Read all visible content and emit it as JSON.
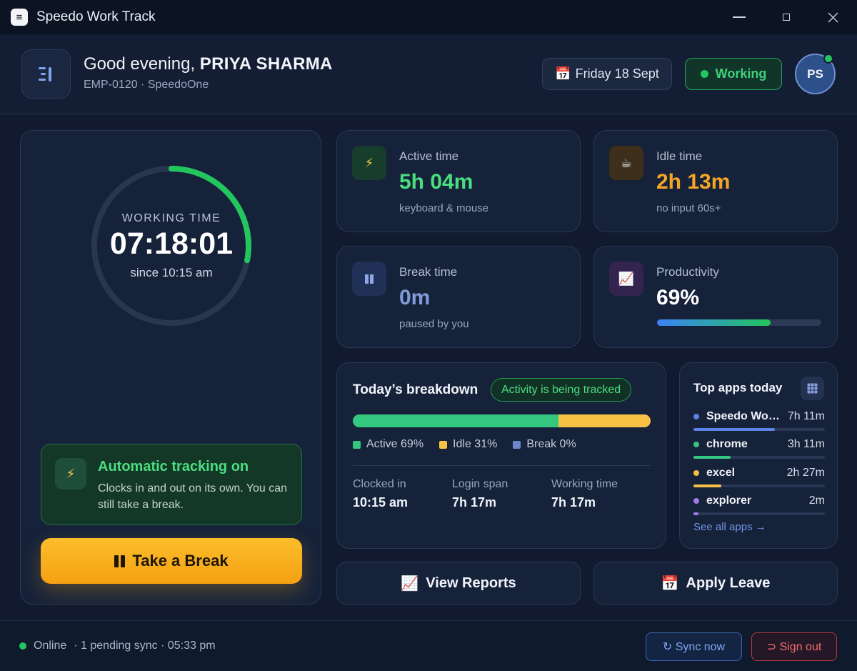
{
  "window": {
    "title": "Speedo Work Track"
  },
  "header": {
    "greeting_prefix": "Good evening,",
    "user_name": "PRIYA SHARMA",
    "subline": "EMP-0120 · SpeedoOne",
    "date_icon": "📅",
    "date_label": "Friday 18 Sept",
    "status_label": "Working",
    "avatar_initials": "PS"
  },
  "timer": {
    "label": "WORKING TIME",
    "value": "07:18:01",
    "since": "since 10:15 am",
    "ring_progress": 0.28
  },
  "auto_tracking": {
    "title": "Automatic tracking on",
    "description": "Clocks in and out on its own. You can still take a break."
  },
  "break_button": {
    "label": "Take a Break"
  },
  "stats": {
    "active": {
      "label": "Active time",
      "value": "5h 04m",
      "sub": "keyboard & mouse",
      "color": "#4ade80",
      "icon": "lightning-icon"
    },
    "idle": {
      "label": "Idle time",
      "value": "2h 13m",
      "sub": "no input 60s+",
      "color": "#f5a524",
      "icon": "coffee-icon"
    },
    "break": {
      "label": "Break time",
      "value": "0m",
      "sub": "paused by you",
      "color": "#7f9bd8",
      "icon": "pause-icon"
    },
    "productivity": {
      "label": "Productivity",
      "value": "69%",
      "fill": 0.69,
      "icon": "chart-up-icon"
    }
  },
  "breakdown": {
    "title": "Today’s breakdown",
    "tracking_pill": "Activity is being tracked",
    "segments": [
      {
        "name": "Active",
        "fraction": 0.69,
        "color": "#34c77f"
      },
      {
        "name": "Idle",
        "fraction": 0.31,
        "color": "#f6c144"
      },
      {
        "name": "Break",
        "fraction": 0.0,
        "color": "#6c86c8"
      }
    ],
    "legend": [
      "Active 69%",
      "Idle 31%",
      "Break 0%"
    ],
    "columns": [
      {
        "label": "Clocked in",
        "value": "10:15 am"
      },
      {
        "label": "Login span",
        "value": "7h 17m"
      },
      {
        "label": "Working time",
        "value": "7h 17m"
      }
    ]
  },
  "top_apps": {
    "title": "Top apps today",
    "items": [
      {
        "name": "Speedo Wo…",
        "time": "7h 11m",
        "color": "#5b82e6",
        "fill": 0.62
      },
      {
        "name": "chrome",
        "time": "3h 11m",
        "color": "#34c77f",
        "fill": 0.28
      },
      {
        "name": "excel",
        "time": "2h 27m",
        "color": "#f6c144",
        "fill": 0.21
      },
      {
        "name": "explorer",
        "time": "2m",
        "color": "#9f7aea",
        "fill": 0.04
      }
    ],
    "see_all": "See all apps →"
  },
  "actions": {
    "reports_icon": "📈",
    "reports_label": "View Reports",
    "leave_icon": "📅",
    "leave_label": "Apply Leave"
  },
  "footer": {
    "status": "Online",
    "detail": "· 1 pending sync · 05:33 pm",
    "sync_label": "↻ Sync now",
    "signout_label": "⊃ Sign out"
  }
}
